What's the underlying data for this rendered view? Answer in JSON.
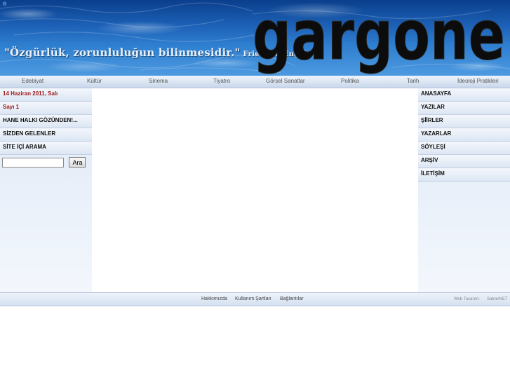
{
  "header": {
    "small_mark": "®",
    "quote": "\"Özgürlük, zorunluluğun bilinmesidir.\"",
    "quote_author": "Friedrich Engels",
    "logo_text": "gargone"
  },
  "topnav": {
    "items": [
      "Edebiyat",
      "Kültür",
      "Sinema",
      "Tiyatro",
      "Görsel Sanatlar",
      "Politika",
      "Tarih",
      "İdeoloji Pratikleri"
    ]
  },
  "left_sidebar": {
    "date": "14 Haziran 2011, Salı",
    "issue": "Sayı 1",
    "items": [
      "HANE HALKI GÖZÜNDEN!...",
      "SİZDEN GELENLER",
      "SİTE İÇİ ARAMA"
    ],
    "search": {
      "value": "",
      "placeholder": "",
      "button": "Ara"
    }
  },
  "right_sidebar": {
    "items": [
      "ANASAYFA",
      "YAZILAR",
      "ŞİİRLER",
      "YAZARLAR",
      "SÖYLEŞİ",
      "ARŞİV",
      "İLETİŞİM"
    ]
  },
  "footer": {
    "links": [
      "Hakkımızda",
      "Kullanım Şartları",
      "Bağlantılar"
    ],
    "credit_label": "Web Tasarım:",
    "credit_name": "SatranNET"
  },
  "colors": {
    "banner_blue": "#1d62b8",
    "date_red": "#a01818",
    "nav_bg": "#d8e3f2"
  }
}
